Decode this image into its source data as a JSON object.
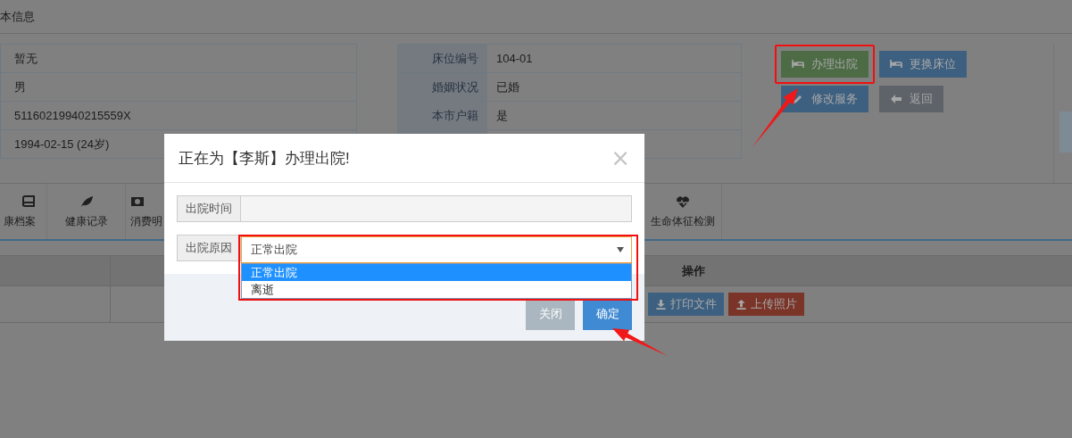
{
  "page_header": {
    "title": "本信息"
  },
  "info_left": [
    {
      "value": "暂无"
    },
    {
      "value": "男"
    },
    {
      "value": "51160219940215559X"
    },
    {
      "value": "1994-02-15 (24岁)"
    }
  ],
  "info_right": [
    {
      "label": "床位编号",
      "value": "104-01"
    },
    {
      "label": "婚姻状况",
      "value": "已婚"
    },
    {
      "label": "本市户籍",
      "value": "是"
    }
  ],
  "actions": [
    {
      "label": "办理出院",
      "kind": "success",
      "highlighted": true
    },
    {
      "label": "更换床位",
      "kind": "primary",
      "highlighted": false
    },
    {
      "label": "修改服务",
      "kind": "primary",
      "highlighted": false
    },
    {
      "label": "返回",
      "kind": "default",
      "highlighted": false
    }
  ],
  "tabs": [
    {
      "label": "康档案"
    },
    {
      "label": "健康记录"
    },
    {
      "label": "消费明"
    },
    {
      "label": "生命体征检测"
    }
  ],
  "table": {
    "columns": [
      "操作"
    ],
    "row_actions": [
      {
        "label": "打印文件",
        "kind": "primary"
      },
      {
        "label": "上传照片",
        "kind": "danger"
      }
    ]
  },
  "dialog": {
    "title": "正在为【李斯】办理出院!",
    "close": "×",
    "fields": [
      {
        "label": "出院时间",
        "kind": "text"
      },
      {
        "label": "出院原因",
        "kind": "select",
        "value": "正常出院",
        "highlighted": true,
        "options": [
          {
            "label": "正常出院",
            "selected": true
          },
          {
            "label": "离逝",
            "selected": false
          }
        ]
      }
    ],
    "buttons": [
      {
        "label": "关闭",
        "kind": "default"
      },
      {
        "label": "确定",
        "kind": "primary"
      }
    ]
  }
}
